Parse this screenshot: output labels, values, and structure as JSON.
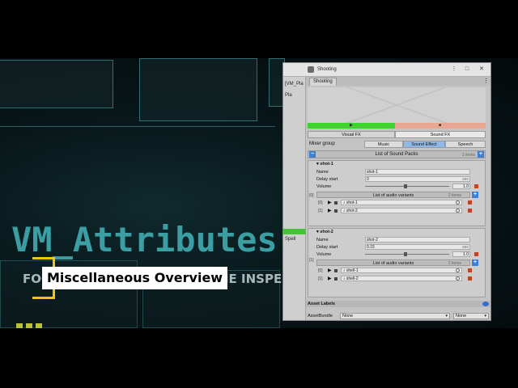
{
  "background": {
    "title": "VM_Attributes",
    "tagline": "FOCUS ON THE GAME, NOT THE INSPECTOR",
    "caption": "Miscellaneous Overview",
    "accent_color": "#f2c40f",
    "title_color": "#3a9ea3"
  },
  "window": {
    "title": "Shooting",
    "tab": "Shooting",
    "left_col": {
      "label_vm": "[VM_Pla",
      "label_pla": "Pla",
      "label_spell": "Spell"
    },
    "fx_tabs": [
      "Visual FX",
      "Sound FX"
    ],
    "mixer": {
      "label": "Mixer group",
      "tabs": [
        "Music",
        "Sound Effect",
        "Speech"
      ]
    },
    "packs": {
      "title": "List of Sound Packs",
      "count": "2 items"
    },
    "shots": [
      {
        "header": "shot-1",
        "index": "[0]",
        "name_label": "Name",
        "name_value": "shot-1",
        "delay_label": "Delay start",
        "delay_value": "0",
        "delay_unit": "sec",
        "volume_label": "Volume",
        "volume_value": "1.0",
        "variants_title": "List of audio variants",
        "variants_count": "2 items",
        "variants": [
          {
            "index": "[0]",
            "clip": "shot-1"
          },
          {
            "index": "[1]",
            "clip": "shot-2"
          }
        ]
      },
      {
        "header": "shot-2",
        "index": "[1]",
        "name_label": "Name",
        "name_value": "shot-2",
        "delay_label": "Delay start",
        "delay_value": "0.15",
        "delay_unit": "sec",
        "volume_label": "Volume",
        "volume_value": "1.0",
        "variants_title": "List of audio variants",
        "variants_count": "2 items",
        "variants": [
          {
            "index": "[0]",
            "clip": "shell-1"
          },
          {
            "index": "[1]",
            "clip": "shell-2"
          }
        ]
      }
    ],
    "asset_labels": "Asset Labels",
    "asset_bundle": {
      "label": "AssetBundle",
      "value1": "None",
      "value2": "None"
    }
  }
}
